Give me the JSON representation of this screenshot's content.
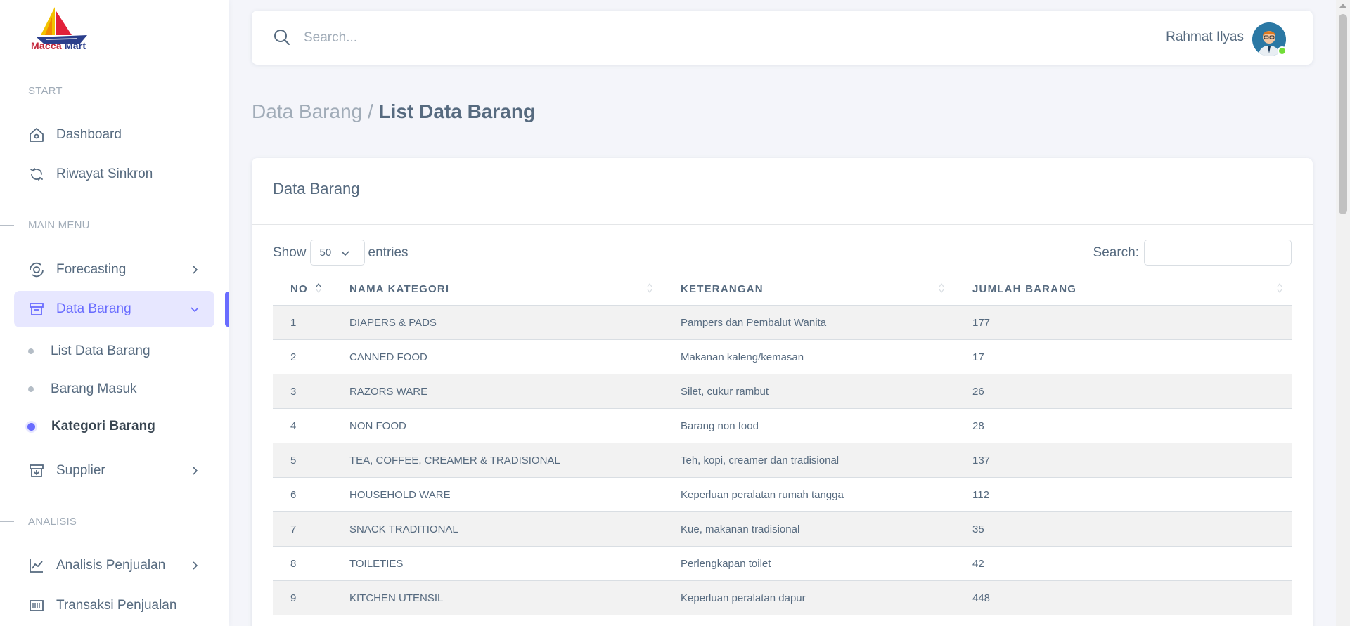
{
  "brand": {
    "name_part1": "Macca",
    "name_part2": "Mart"
  },
  "sidebar": {
    "sections": [
      {
        "label": "START"
      },
      {
        "label": "MAIN MENU"
      },
      {
        "label": "ANALISIS"
      }
    ],
    "items": [
      {
        "label": "Dashboard",
        "icon": "home-icon"
      },
      {
        "label": "Riwayat Sinkron",
        "icon": "sync-icon"
      },
      {
        "label": "Forecasting",
        "icon": "forecast-icon"
      },
      {
        "label": "Data Barang",
        "icon": "archive-icon"
      },
      {
        "label": "Supplier",
        "icon": "box-icon"
      },
      {
        "label": "Analisis Penjualan",
        "icon": "chart-line-icon"
      },
      {
        "label": "Transaksi Penjualan",
        "icon": "barcode-icon"
      }
    ],
    "subitems": [
      {
        "label": "List Data Barang"
      },
      {
        "label": "Barang Masuk"
      },
      {
        "label": "Kategori Barang"
      }
    ],
    "accent_color": "#696cff"
  },
  "navbar": {
    "search_placeholder": "Search...",
    "user_name": "Rahmat Ilyas"
  },
  "breadcrumb": {
    "parent": "Data Barang",
    "separator": "/",
    "current": "List Data Barang"
  },
  "card": {
    "title": "Data Barang",
    "show_label": "Show",
    "entries_value": "50",
    "entries_label": "entries",
    "search_label": "Search:"
  },
  "table": {
    "columns": [
      "NO",
      "NAMA KATEGORI",
      "KETERANGAN",
      "JUMLAH BARANG"
    ],
    "rows": [
      {
        "no": "1",
        "nama": "DIAPERS & PADS",
        "ket": "Pampers dan Pembalut Wanita",
        "jumlah": "177"
      },
      {
        "no": "2",
        "nama": "CANNED FOOD",
        "ket": "Makanan kaleng/kemasan",
        "jumlah": "17"
      },
      {
        "no": "3",
        "nama": "RAZORS WARE",
        "ket": "Silet, cukur rambut",
        "jumlah": "26"
      },
      {
        "no": "4",
        "nama": "NON FOOD",
        "ket": "Barang non food",
        "jumlah": "28"
      },
      {
        "no": "5",
        "nama": "TEA, COFFEE, CREAMER & TRADISIONAL",
        "ket": "Teh, kopi, creamer dan tradisional",
        "jumlah": "137"
      },
      {
        "no": "6",
        "nama": "HOUSEHOLD WARE",
        "ket": "Keperluan peralatan rumah tangga",
        "jumlah": "112"
      },
      {
        "no": "7",
        "nama": "SNACK TRADITIONAL",
        "ket": "Kue, makanan tradisional",
        "jumlah": "35"
      },
      {
        "no": "8",
        "nama": "TOILETIES",
        "ket": "Perlengkapan toilet",
        "jumlah": "42"
      },
      {
        "no": "9",
        "nama": "KITCHEN UTENSIL",
        "ket": "Keperluan peralatan dapur",
        "jumlah": "448"
      }
    ]
  }
}
